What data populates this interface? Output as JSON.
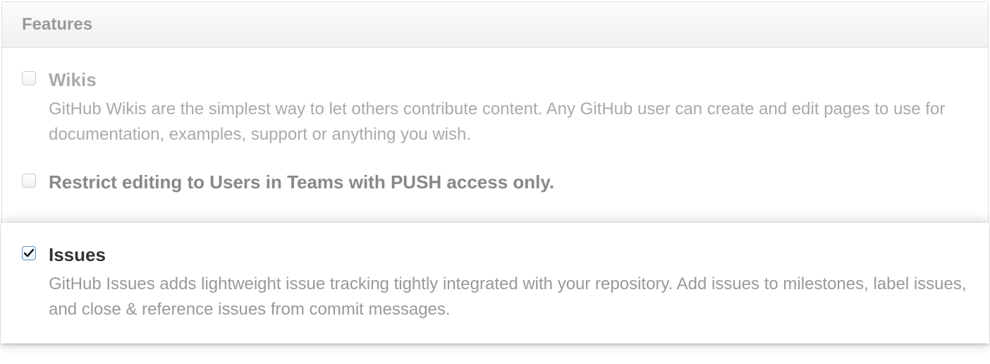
{
  "panel": {
    "title": "Features"
  },
  "features": {
    "wikis": {
      "label": "Wikis",
      "desc": "GitHub Wikis are the simplest way to let others contribute content. Any GitHub user can create and edit pages to use for documentation, examples, support or anything you wish.",
      "checked": false
    },
    "restrict": {
      "label": "Restrict editing to Users in Teams with PUSH access only.",
      "checked": false
    },
    "issues": {
      "label": "Issues",
      "desc": "GitHub Issues adds lightweight issue tracking tightly integrated with your repository. Add issues to milestones, label issues, and close & reference issues from commit messages.",
      "checked": true
    }
  }
}
